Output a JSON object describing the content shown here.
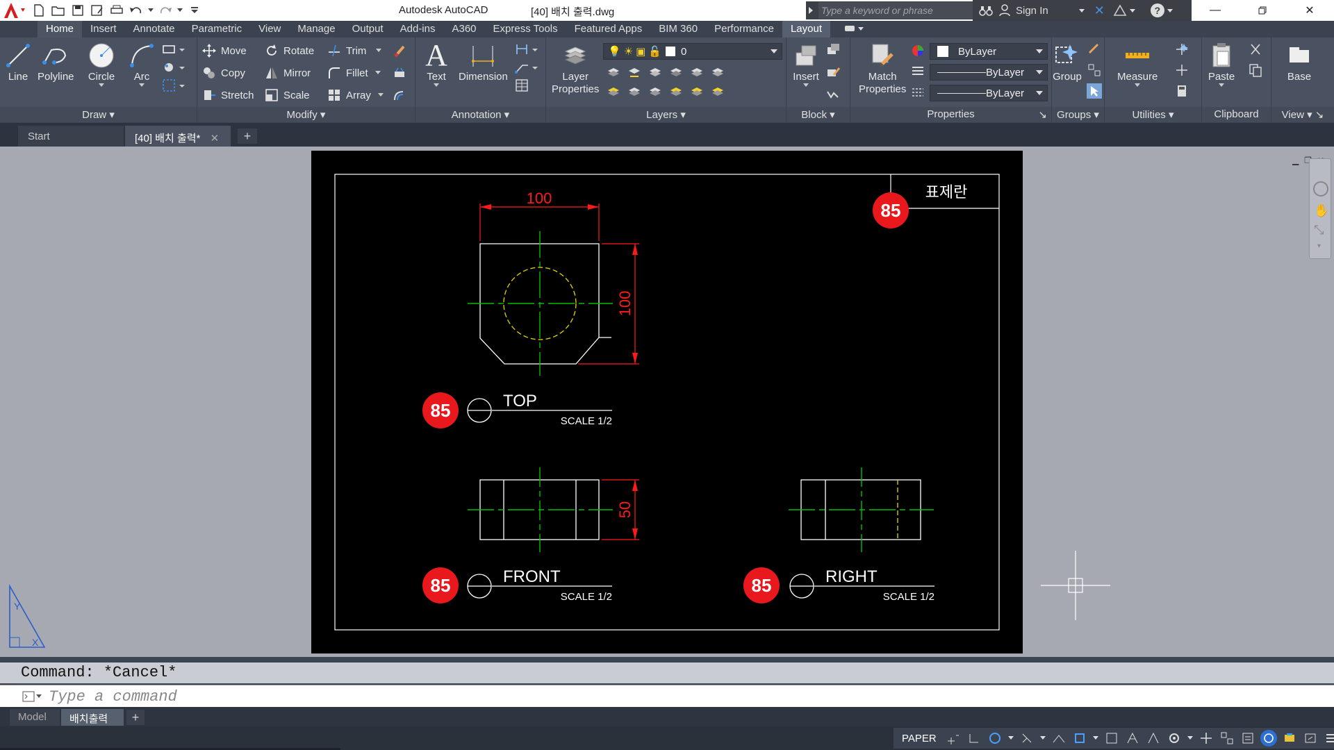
{
  "title_bar": {
    "app_name": "Autodesk AutoCAD",
    "file_name": "[40] 배치 출력.dwg",
    "search_placeholder": "Type a keyword or phrase",
    "sign_in": "Sign In"
  },
  "ribbon_tabs": [
    "Home",
    "Insert",
    "Annotate",
    "Parametric",
    "View",
    "Manage",
    "Output",
    "Add-ins",
    "A360",
    "Express Tools",
    "Featured Apps",
    "BIM 360",
    "Performance",
    "Layout"
  ],
  "ribbon": {
    "draw": {
      "title": "Draw",
      "line": "Line",
      "polyline": "Polyline",
      "circle": "Circle",
      "arc": "Arc"
    },
    "modify": {
      "title": "Modify",
      "move": "Move",
      "rotate": "Rotate",
      "trim": "Trim",
      "copy": "Copy",
      "mirror": "Mirror",
      "fillet": "Fillet",
      "stretch": "Stretch",
      "scale": "Scale",
      "array": "Array"
    },
    "annotation": {
      "title": "Annotation",
      "text": "Text",
      "dimension": "Dimension"
    },
    "layers": {
      "title": "Layers",
      "layer_properties_1": "Layer",
      "layer_properties_2": "Properties",
      "current_layer": "0"
    },
    "block": {
      "title": "Block",
      "insert": "Insert"
    },
    "properties": {
      "title": "Properties",
      "match_1": "Match",
      "match_2": "Properties",
      "color": "ByLayer",
      "linetype": "ByLayer",
      "lineweight": "ByLayer"
    },
    "groups": {
      "title": "Groups",
      "group": "Group"
    },
    "utilities": {
      "title": "Utilities",
      "measure": "Measure"
    },
    "clipboard": {
      "title": "Clipboard",
      "paste": "Paste"
    },
    "view": {
      "title": "View",
      "base": "Base"
    }
  },
  "doc_tabs": {
    "start": "Start",
    "active": "[40] 배치 출력*"
  },
  "drawing": {
    "top_dim_width": "100",
    "top_dim_height": "100",
    "front_dim_height": "50",
    "title_block_label": "표제란",
    "views": [
      {
        "name": "TOP",
        "scale": "SCALE 1/2",
        "badge": "85"
      },
      {
        "name": "FRONT",
        "scale": "SCALE 1/2",
        "badge": "85"
      },
      {
        "name": "RIGHT",
        "scale": "SCALE 1/2",
        "badge": "85"
      }
    ],
    "title_badge": "85"
  },
  "command_line": {
    "history": "Command: *Cancel*",
    "placeholder": "Type a command"
  },
  "layout_tabs": {
    "model": "Model",
    "layout": "배치출력"
  },
  "status_bar": {
    "paper": "PAPER"
  },
  "colors": {
    "dim_red": "#ff1a1a",
    "center_green": "#00c000",
    "hidden_yellow": "#d8c800",
    "badge_red": "#e8181c"
  }
}
